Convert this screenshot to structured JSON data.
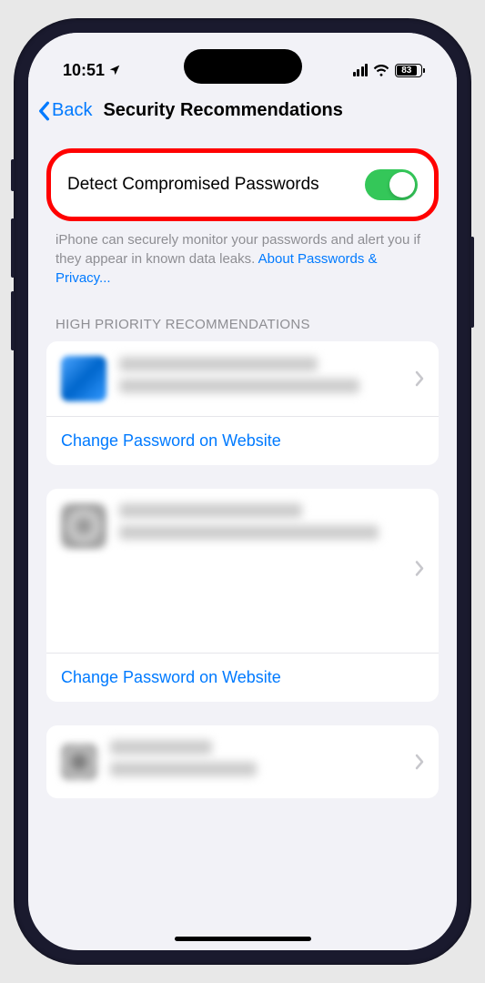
{
  "status": {
    "time": "10:51",
    "battery": "83"
  },
  "nav": {
    "back": "Back",
    "title": "Security Recommendations"
  },
  "detect": {
    "label": "Detect Compromised Passwords",
    "enabled": true,
    "footer": "iPhone can securely monitor your passwords and alert you if they appear in known data leaks. ",
    "footer_link": "About Passwords & Privacy..."
  },
  "section_header": "HIGH PRIORITY RECOMMENDATIONS",
  "action_label": "Change Password on Website"
}
